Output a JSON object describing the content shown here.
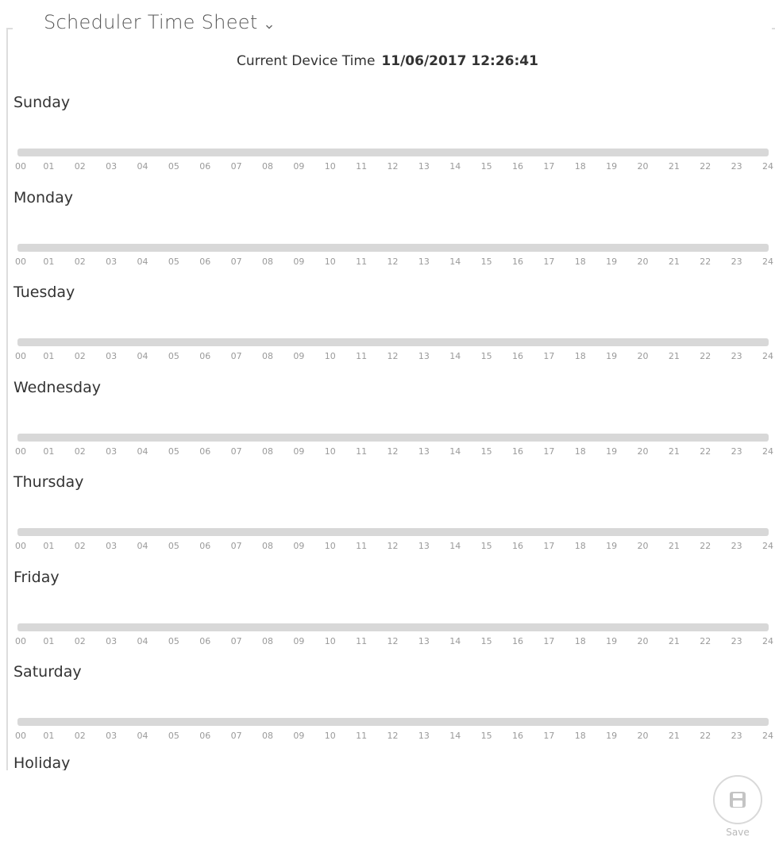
{
  "section": {
    "title": "Scheduler Time Sheet"
  },
  "device_time": {
    "label": "Current Device Time",
    "value": "11/06/2017 12:26:41"
  },
  "hours": [
    "00",
    "01",
    "02",
    "03",
    "04",
    "05",
    "06",
    "07",
    "08",
    "09",
    "10",
    "11",
    "12",
    "13",
    "14",
    "15",
    "16",
    "17",
    "18",
    "19",
    "20",
    "21",
    "22",
    "23",
    "24"
  ],
  "days": [
    {
      "label": "Sunday"
    },
    {
      "label": "Monday"
    },
    {
      "label": "Tuesday"
    },
    {
      "label": "Wednesday"
    },
    {
      "label": "Thursday"
    },
    {
      "label": "Friday"
    },
    {
      "label": "Saturday"
    }
  ],
  "holiday": {
    "label": "Holiday"
  },
  "save": {
    "label": "Save",
    "icon": "floppy-disk-icon"
  },
  "colors": {
    "track": "#d8d8d8",
    "tick_text": "#9a9a9a",
    "save_border": "#d9d9d9"
  }
}
